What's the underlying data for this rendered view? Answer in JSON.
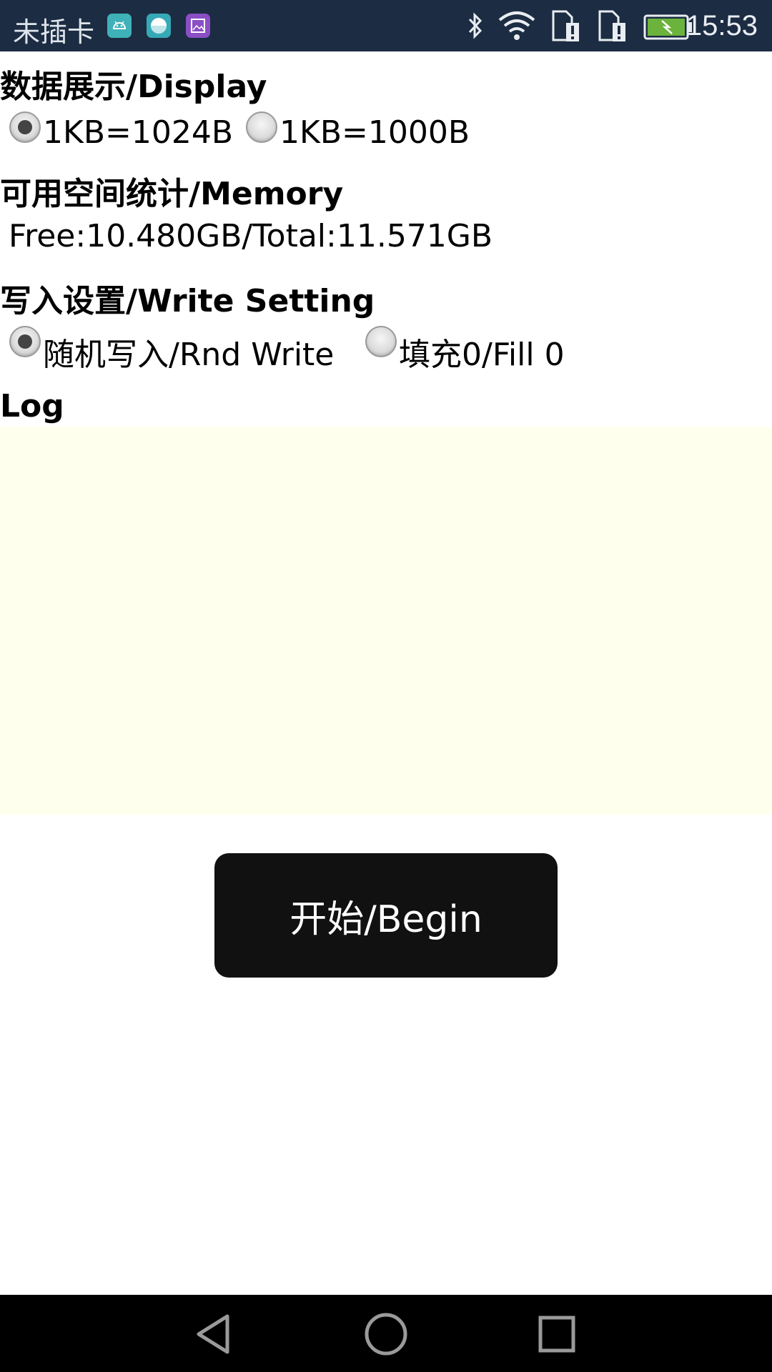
{
  "status_bar": {
    "carrier": "未插卡",
    "app_icons": [
      "android-icon",
      "cleaner-icon",
      "gallery-icon"
    ],
    "right_icons": [
      "bluetooth-icon",
      "wifi-icon",
      "sim1-icon",
      "sim2-icon",
      "battery-icon"
    ],
    "time": "15:53",
    "colors": {
      "background": "#1c2c42",
      "battery": "#6bb33c"
    }
  },
  "display_section": {
    "title": "数据展示/Display",
    "options": [
      {
        "label": "1KB=1024B",
        "selected": true
      },
      {
        "label": "1KB=1000B",
        "selected": false
      }
    ]
  },
  "memory_section": {
    "title": "可用空间统计/Memory",
    "value": "Free:10.480GB/Total:11.571GB"
  },
  "write_section": {
    "title": "写入设置/Write Setting",
    "options": [
      {
        "label": "随机写入/Rnd Write",
        "selected": true
      },
      {
        "label": "填充0/Fill 0",
        "selected": false
      }
    ]
  },
  "log_section": {
    "title": "Log",
    "content": "",
    "background": "#ffffee"
  },
  "begin_button": {
    "label": "开始/Begin"
  },
  "nav_bar": {
    "buttons": [
      "back-icon",
      "home-icon",
      "recents-icon"
    ]
  }
}
